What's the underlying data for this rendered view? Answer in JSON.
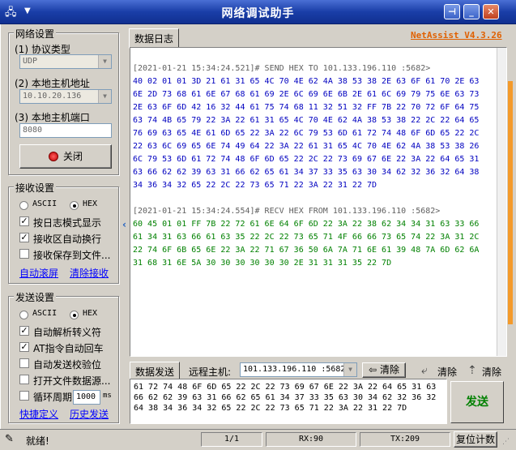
{
  "window": {
    "title": "网络调试助手",
    "brand": "NetAssist V4.3.26"
  },
  "network": {
    "group_title": "网络设置",
    "protocol_label": "(1) 协议类型",
    "protocol_value": "UDP",
    "host_label": "(2) 本地主机地址",
    "host_value": "10.10.20.136",
    "port_label": "(3) 本地主机端口",
    "port_value": "8080",
    "close_button": "关闭"
  },
  "receive": {
    "group_title": "接收设置",
    "ascii": "ASCII",
    "hex": "HEX",
    "opt_log": "按日志模式显示",
    "opt_wrap": "接收区自动换行",
    "opt_save": "接收保存到文件...",
    "auto_scroll": "自动滚屏",
    "clear_recv": "清除接收"
  },
  "send": {
    "group_title": "发送设置",
    "ascii": "ASCII",
    "hex": "HEX",
    "opt_escape": "自动解析转义符",
    "opt_at": "AT指令自动回车",
    "opt_checksum": "自动发送校验位",
    "opt_file": "打开文件数据源...",
    "opt_cycle": "循环周期",
    "cycle_value": "1000",
    "cycle_unit": "ms",
    "shortcut": "快捷定义",
    "history": "历史发送"
  },
  "log": {
    "tab": "数据日志",
    "entries": [
      {
        "header": "[2021-01-21 15:34:24.521]# SEND HEX TO 101.133.196.110 :5682>",
        "lines": [
          "40 02 01 01 3D 21 61 31 65 4C 70 4E 62 4A 38 53 38 2E 63 6F 61 70 2E 63",
          "6E 2D 73 68 61 6E 67 68 61 69 2E 6C 69 6E 6B 2E 61 6C 69 79 75 6E 63 73",
          "2E 63 6F 6D 42 16 32 44 61 75 74 68 11 32 51 32 FF 7B 22 70 72 6F 64 75",
          "63 74 4B 65 79 22 3A 22 61 31 65 4C 70 4E 62 4A 38 53 38 22 2C 22 64 65",
          "76 69 63 65 4E 61 6D 65 22 3A 22 6C 79 53 6D 61 72 74 48 6F 6D 65 22 2C",
          "22 63 6C 69 65 6E 74 49 64 22 3A 22 61 31 65 4C 70 4E 62 4A 38 53 38 26",
          "6C 79 53 6D 61 72 74 48 6F 6D 65 22 2C 22 73 69 67 6E 22 3A 22 64 65 31",
          "63 66 62 62 39 63 31 66 62 65 61 34 37 33 35 63 30 34 62 32 36 32 64 38",
          "34 36 34 32 65 22 2C 22 73 65 71 22 3A 22 31 22 7D"
        ]
      },
      {
        "header": "[2021-01-21 15:34:24.554]# RECV HEX FROM 101.133.196.110 :5682>",
        "lines": [
          "60 45 01 01 FF 7B 22 72 61 6E 64 6F 6D 22 3A 22 38 62 34 34 31 63 33 66",
          "61 34 31 63 66 61 63 35 22 2C 22 73 65 71 4F 66 66 73 65 74 22 3A 31 2C",
          "22 74 6F 6B 65 6E 22 3A 22 71 67 36 50 6A 7A 71 6E 61 39 48 7A 6D 62 6A",
          "31 68 31 6E 5A 30 30 30 30 30 30 2E 31 31 31 35 22 7D"
        ]
      }
    ]
  },
  "sendbar": {
    "tab": "数据发送",
    "remote_label": "远程主机:",
    "remote_value": "101.133.196.110 :5682",
    "clear1": "清除",
    "clear2": "清除",
    "clear3": "清除",
    "send_text": "61 72 74 48 6F 6D 65 22 2C 22 73 69 67 6E 22 3A 22 64 65 31 63 66 62 62 39 63 31 66 62 65 61 34 37 33 35 63 30 34 62 32 36 32 64 38 34 36 34 32 65 22 2C 22 73 65 71 22 3A 22 31 22 7D",
    "send_button": "发送"
  },
  "status": {
    "ready": "就绪!",
    "page": "1/1",
    "rx": "RX:90",
    "tx": "TX:209",
    "reset": "复位计数"
  }
}
